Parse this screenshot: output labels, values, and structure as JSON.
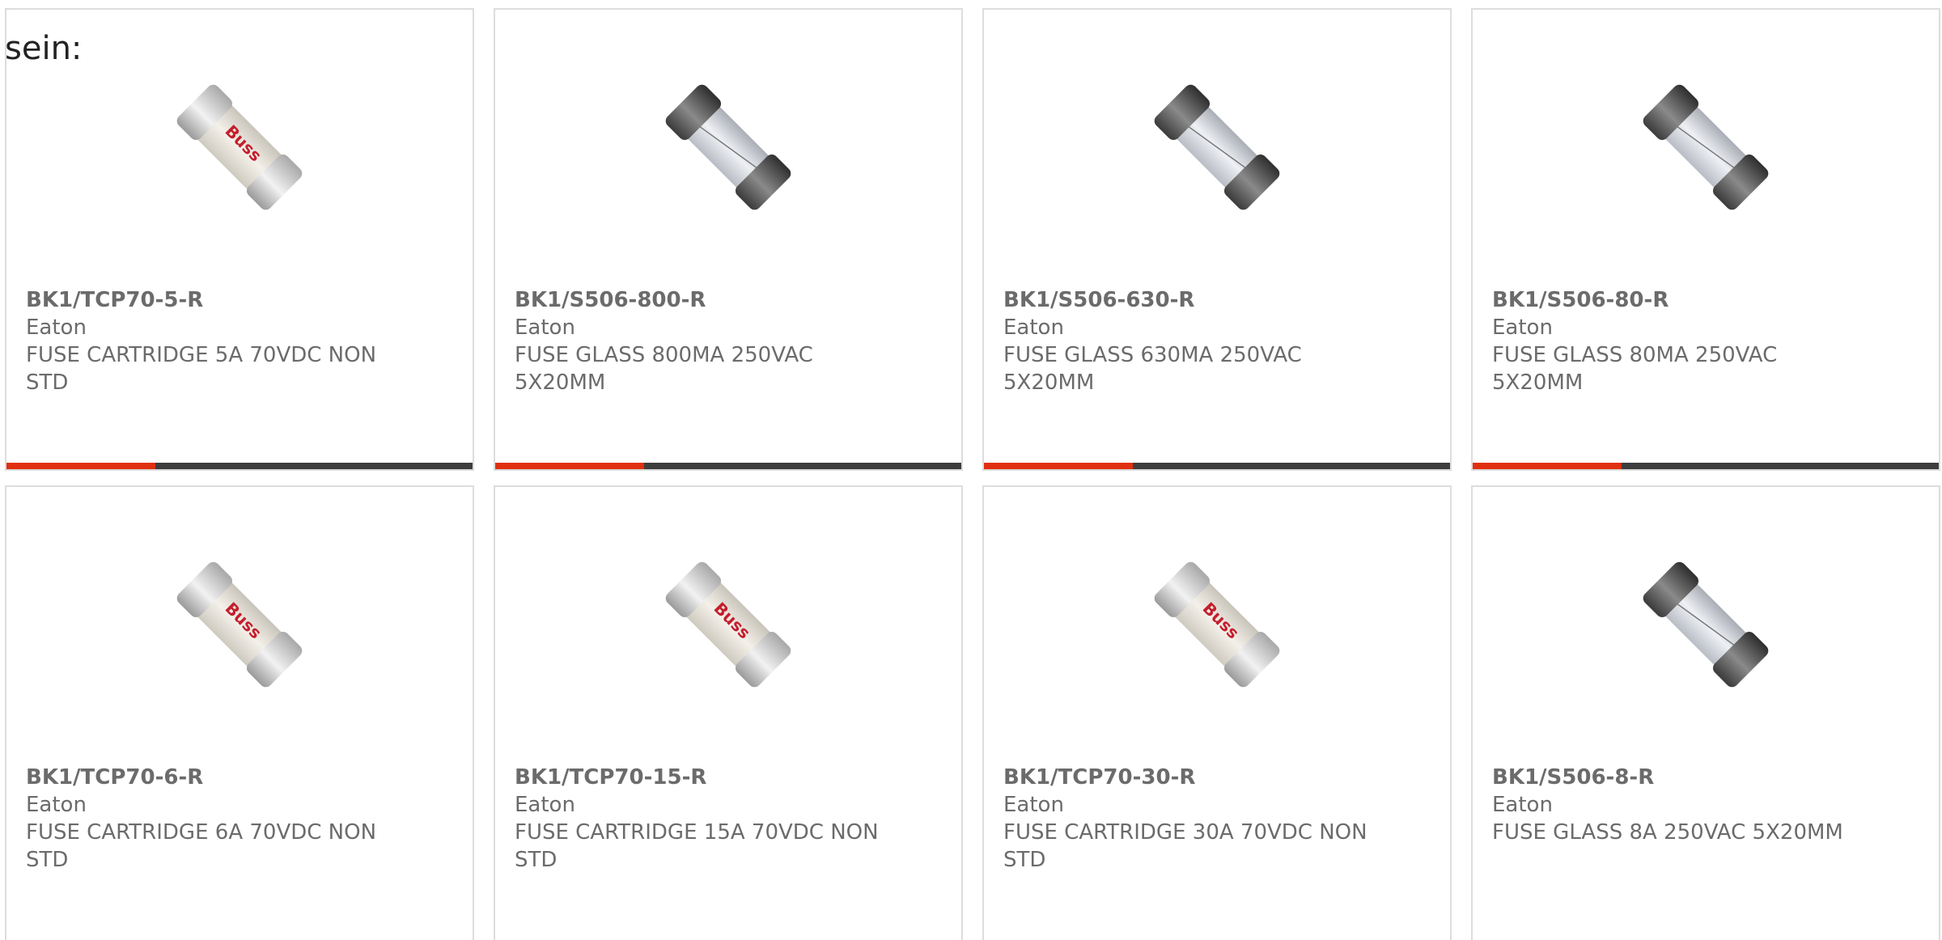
{
  "intro_text": "sein:",
  "colors": {
    "accent": "#e03010",
    "bar": "#3d3d3d",
    "text": "#6b6b6b",
    "border": "#dddddd"
  },
  "products": [
    {
      "part": "BK1/TCP70-5-R",
      "maker": "Eaton",
      "desc": "FUSE CARTRIDGE 5A 70VDC NON STD",
      "image": "ceramic-fuse-icon",
      "brand_mark": "Buss"
    },
    {
      "part": "BK1/S506-800-R",
      "maker": "Eaton",
      "desc": "FUSE GLASS 800MA 250VAC 5X20MM",
      "image": "glass-fuse-icon"
    },
    {
      "part": "BK1/S506-630-R",
      "maker": "Eaton",
      "desc": "FUSE GLASS 630MA 250VAC 5X20MM",
      "image": "glass-fuse-icon"
    },
    {
      "part": "BK1/S506-80-R",
      "maker": "Eaton",
      "desc": "FUSE GLASS 80MA 250VAC 5X20MM",
      "image": "glass-fuse-icon"
    },
    {
      "part": "BK1/TCP70-6-R",
      "maker": "Eaton",
      "desc": "FUSE CARTRIDGE 6A 70VDC NON STD",
      "image": "ceramic-fuse-icon",
      "brand_mark": "Buss"
    },
    {
      "part": "BK1/TCP70-15-R",
      "maker": "Eaton",
      "desc": "FUSE CARTRIDGE 15A 70VDC NON STD",
      "image": "ceramic-fuse-icon",
      "brand_mark": "Buss"
    },
    {
      "part": "BK1/TCP70-30-R",
      "maker": "Eaton",
      "desc": "FUSE CARTRIDGE 30A 70VDC NON STD",
      "image": "ceramic-fuse-icon",
      "brand_mark": "Buss"
    },
    {
      "part": "BK1/S506-8-R",
      "maker": "Eaton",
      "desc": "FUSE GLASS 8A 250VAC 5X20MM",
      "image": "glass-fuse-icon"
    }
  ]
}
